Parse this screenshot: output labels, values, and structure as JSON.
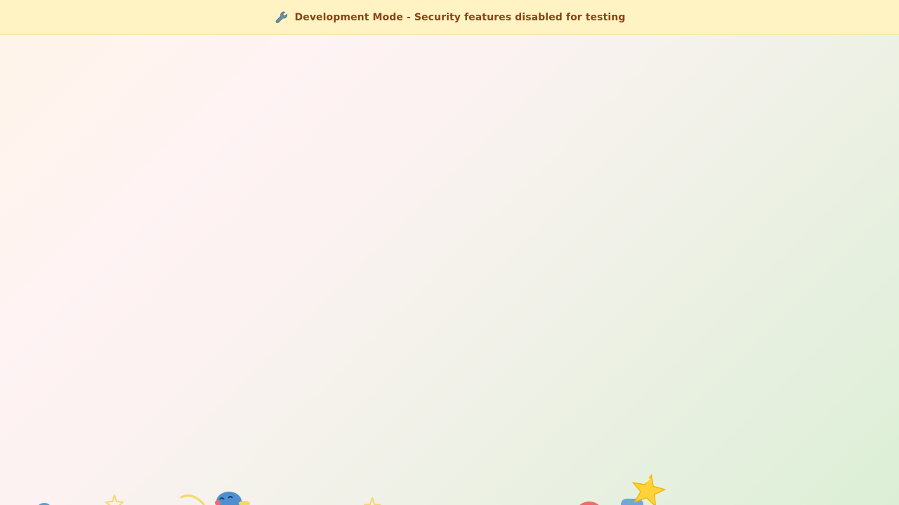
{
  "banner": {
    "icon": "wrench-icon",
    "text": "Development Mode - Security features disabled for testing",
    "background": "#fff3c4",
    "text_color": "#8a4311"
  },
  "decorations": [
    {
      "icon": "blue-circle-icon",
      "color": "#5b9bd5"
    },
    {
      "icon": "star-outline-icon",
      "color": "#f6d76a"
    },
    {
      "icon": "banana-outline-icon",
      "color": "#f6d76a"
    },
    {
      "icon": "blue-character-icon",
      "color": "#4f8fd1"
    },
    {
      "icon": "star-outline-icon",
      "color": "#f6d76a"
    },
    {
      "icon": "red-circle-icon",
      "color": "#ef6b6b"
    },
    {
      "icon": "blue-piece-icon",
      "color": "#6fa7dd"
    },
    {
      "icon": "star-icon",
      "color": "#ffd23a"
    }
  ]
}
